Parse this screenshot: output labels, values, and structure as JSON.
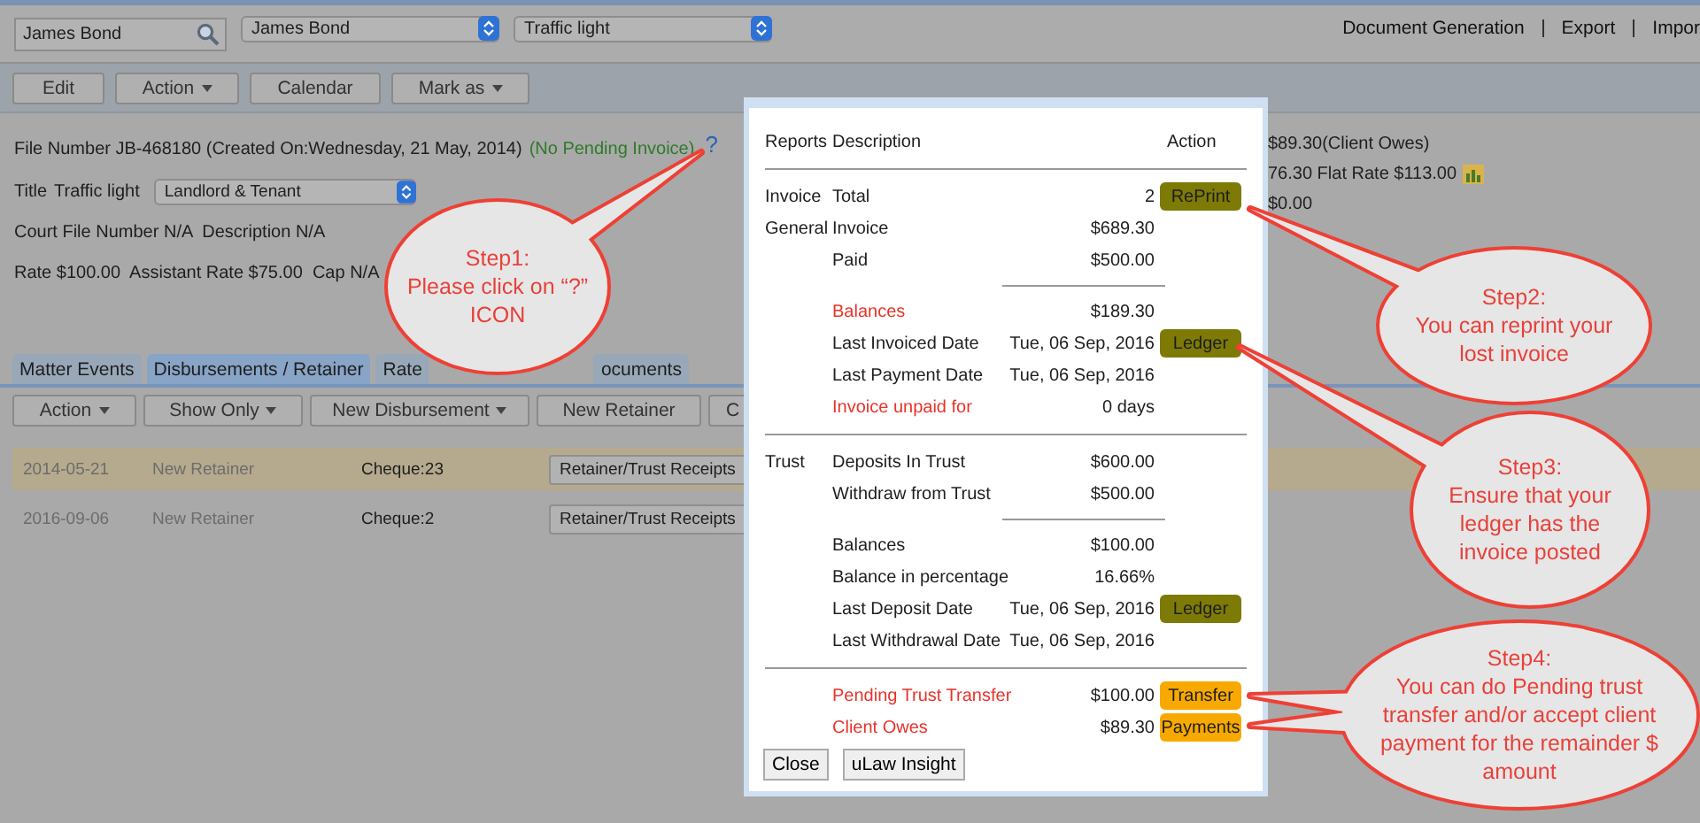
{
  "top_bar": {
    "search": {
      "value": "James Bond"
    },
    "selects": [
      "James Bond",
      "Traffic light"
    ],
    "links": [
      "Document Generation",
      "Export",
      "Impor"
    ]
  },
  "toolbar": [
    {
      "label": "Edit",
      "dropdown": false
    },
    {
      "label": "Action",
      "dropdown": true
    },
    {
      "label": "Calendar",
      "dropdown": false
    },
    {
      "label": "Mark as",
      "dropdown": true
    }
  ],
  "file_info": {
    "file_number": "File Number JB-468180 (Created On:Wednesday, 21 May, 2014)",
    "invoice_status": "(No Pending Invoice)",
    "help": "?",
    "title_label": "Title",
    "title_value": "Traffic light",
    "category": "Landlord & Tenant",
    "lines": [
      "Court File Number N/A  Description N/A",
      "Rate $100.00  Assistant Rate $75.00  Cap N/A"
    ]
  },
  "summary": [
    "$89.30(Client Owes)",
    "76.30 Flat Rate $113.00",
    "$0.00"
  ],
  "tabs": [
    {
      "label": "Matter Events",
      "selected": false
    },
    {
      "label": "Disbursements / Retainer",
      "selected": true
    },
    {
      "label": "Rate",
      "selected": false
    },
    {
      "label": "ocuments",
      "selected": false
    }
  ],
  "sub_toolbar": [
    {
      "label": "Action",
      "dropdown": true
    },
    {
      "label": "Show Only",
      "dropdown": true
    },
    {
      "label": "New Disbursement",
      "dropdown": true
    },
    {
      "label": "New Retainer",
      "dropdown": false
    },
    {
      "label": "C",
      "dropdown": false
    }
  ],
  "rows": [
    {
      "date": "2014-05-21",
      "type": "New Retainer",
      "reference": "Cheque:23",
      "category": "Retainer/Trust Receipts",
      "selected": true
    },
    {
      "date": "2016-09-06",
      "type": "New Retainer",
      "reference": "Cheque:2",
      "category": "Retainer/Trust Receipts",
      "selected": false
    }
  ],
  "popup": {
    "header": {
      "reports": "Reports",
      "description": "Description",
      "action": "Action"
    },
    "items": [
      {
        "kind": "row",
        "group": "Invoice",
        "label": "Total",
        "value": "2",
        "alert": false,
        "action": {
          "label": "RePrint",
          "kind": "olive"
        }
      },
      {
        "kind": "row",
        "group": "General",
        "label": "Invoice",
        "value": "$689.30",
        "alert": false
      },
      {
        "kind": "row",
        "label": "Paid",
        "value": "$500.00",
        "alert": false
      },
      {
        "kind": "short_rule"
      },
      {
        "kind": "row",
        "label": "Balances",
        "value": "$189.30",
        "alert": true
      },
      {
        "kind": "row",
        "label": "Last Invoiced Date",
        "value": "Tue, 06 Sep, 2016",
        "alert": false,
        "action": {
          "label": "Ledger",
          "kind": "olive"
        }
      },
      {
        "kind": "row",
        "label": "Last Payment Date",
        "value": "Tue, 06 Sep, 2016",
        "alert": false
      },
      {
        "kind": "row",
        "label": "Invoice unpaid for",
        "value": "0 days",
        "alert": true
      },
      {
        "kind": "rule"
      },
      {
        "kind": "row",
        "group": "Trust",
        "label": "Deposits In Trust",
        "value": "$600.00",
        "alert": false
      },
      {
        "kind": "row",
        "label": "Withdraw from Trust",
        "value": "$500.00",
        "alert": false
      },
      {
        "kind": "short_rule"
      },
      {
        "kind": "row",
        "label": "Balances",
        "value": "$100.00",
        "alert": false
      },
      {
        "kind": "row",
        "label": "Balance in percentage",
        "value": "16.66%",
        "alert": false
      },
      {
        "kind": "row",
        "label": "Last Deposit Date",
        "value": "Tue, 06 Sep, 2016",
        "alert": false,
        "action": {
          "label": "Ledger",
          "kind": "olive"
        }
      },
      {
        "kind": "row",
        "label": "Last Withdrawal Date",
        "value": "Tue, 06 Sep, 2016",
        "alert": false
      },
      {
        "kind": "rule"
      },
      {
        "kind": "row",
        "label": "Pending Trust Transfer",
        "value": "$100.00",
        "alert": true,
        "action": {
          "label": "Transfer",
          "kind": "orange"
        }
      },
      {
        "kind": "row",
        "label": "Client Owes",
        "value": "$89.30",
        "alert": true,
        "action": {
          "label": "Payments",
          "kind": "orange"
        }
      }
    ],
    "buttons": [
      "Close",
      "uLaw Insight"
    ]
  },
  "callouts": [
    {
      "title": "Step1:",
      "text": "Please click on “?” ICON"
    },
    {
      "title": "Step2:",
      "text": "You can reprint your lost invoice"
    },
    {
      "title": "Step3:",
      "text": "Ensure that your ledger has the invoice posted"
    },
    {
      "title": "Step4:",
      "text": "You can do Pending trust transfer and/or accept client payment for the remainder $ amount"
    }
  ]
}
